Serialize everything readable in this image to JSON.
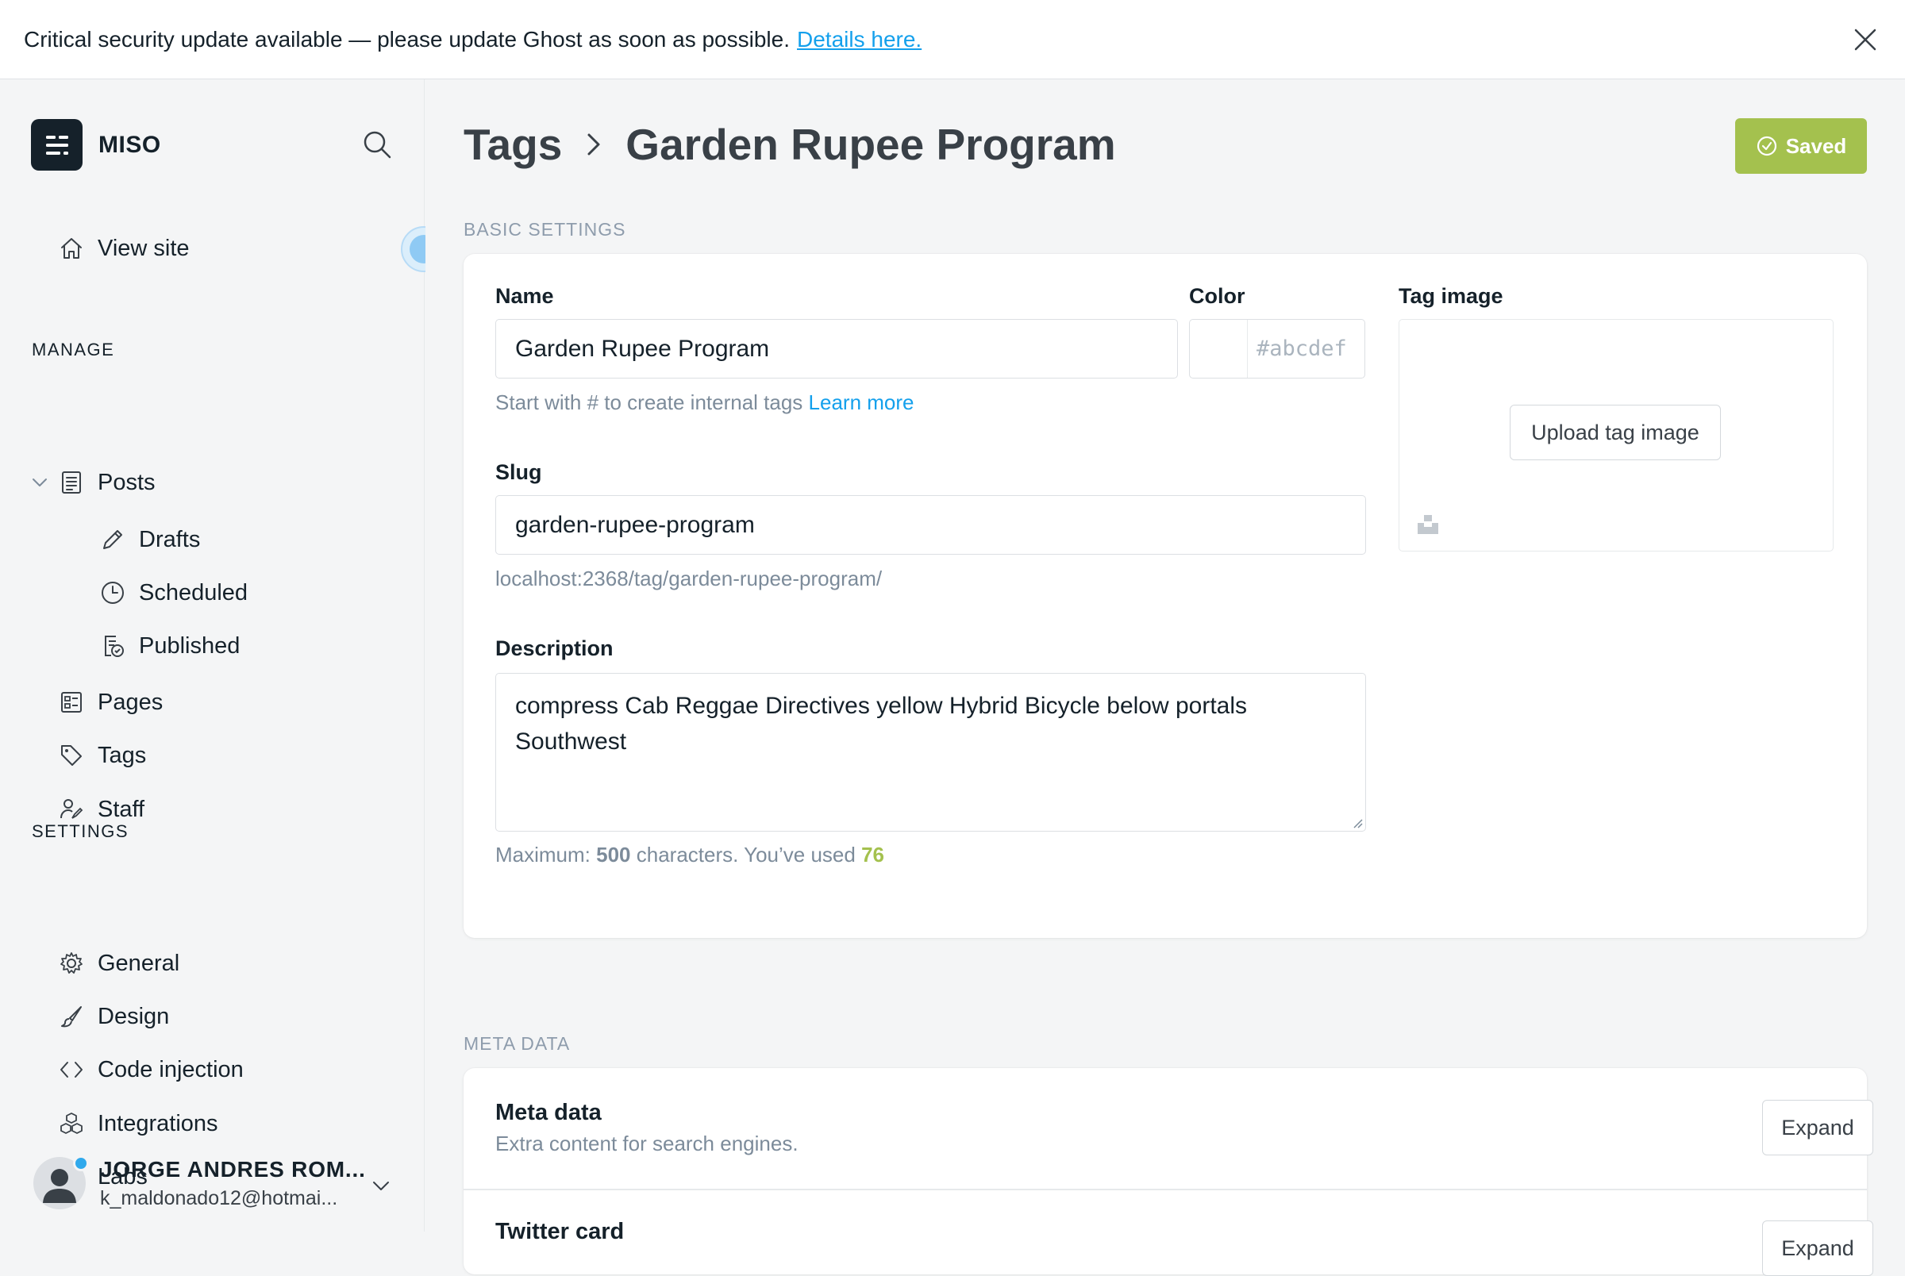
{
  "banner": {
    "message": "Critical security update available — please update Ghost as soon as possible.",
    "link_text": "Details here."
  },
  "sidebar": {
    "site_name": "MISO",
    "view_site": "View site",
    "manage_label": "MANAGE",
    "posts": "Posts",
    "drafts": "Drafts",
    "scheduled": "Scheduled",
    "published": "Published",
    "pages": "Pages",
    "tags": "Tags",
    "staff": "Staff",
    "settings_label": "SETTINGS",
    "general": "General",
    "design": "Design",
    "code_injection": "Code injection",
    "integrations": "Integrations",
    "labs": "Labs",
    "user": {
      "name": "JORGE ANDRES ROM...",
      "email": "k_maldonado12@hotmai..."
    }
  },
  "header": {
    "crumb_root": "Tags",
    "crumb_current": "Garden Rupee Program",
    "saved_label": "Saved"
  },
  "basic": {
    "section_label": "BASIC SETTINGS",
    "name_label": "Name",
    "name_value": "Garden Rupee Program",
    "name_help": "Start with # to create internal tags",
    "name_help_link": "Learn more",
    "color_label": "Color",
    "color_placeholder": "#abcdef",
    "tag_image_label": "Tag image",
    "upload_label": "Upload tag image",
    "slug_label": "Slug",
    "slug_value": "garden-rupee-program",
    "slug_url": "localhost:2368/tag/garden-rupee-program/",
    "description_label": "Description",
    "description_value": "compress Cab Reggae Directives yellow Hybrid Bicycle below portals Southwest",
    "count_prefix": "Maximum:",
    "count_max": "500",
    "count_middle": "characters. You’ve used",
    "count_used": "76"
  },
  "meta": {
    "section_label": "META DATA",
    "meta_title": "Meta data",
    "meta_sub": "Extra content for search engines.",
    "expand_label": "Expand",
    "twitter_title": "Twitter card"
  },
  "colors": {
    "accent_green": "#a4c14e",
    "link_blue": "#14a0ec",
    "text_dark": "#15212a"
  }
}
